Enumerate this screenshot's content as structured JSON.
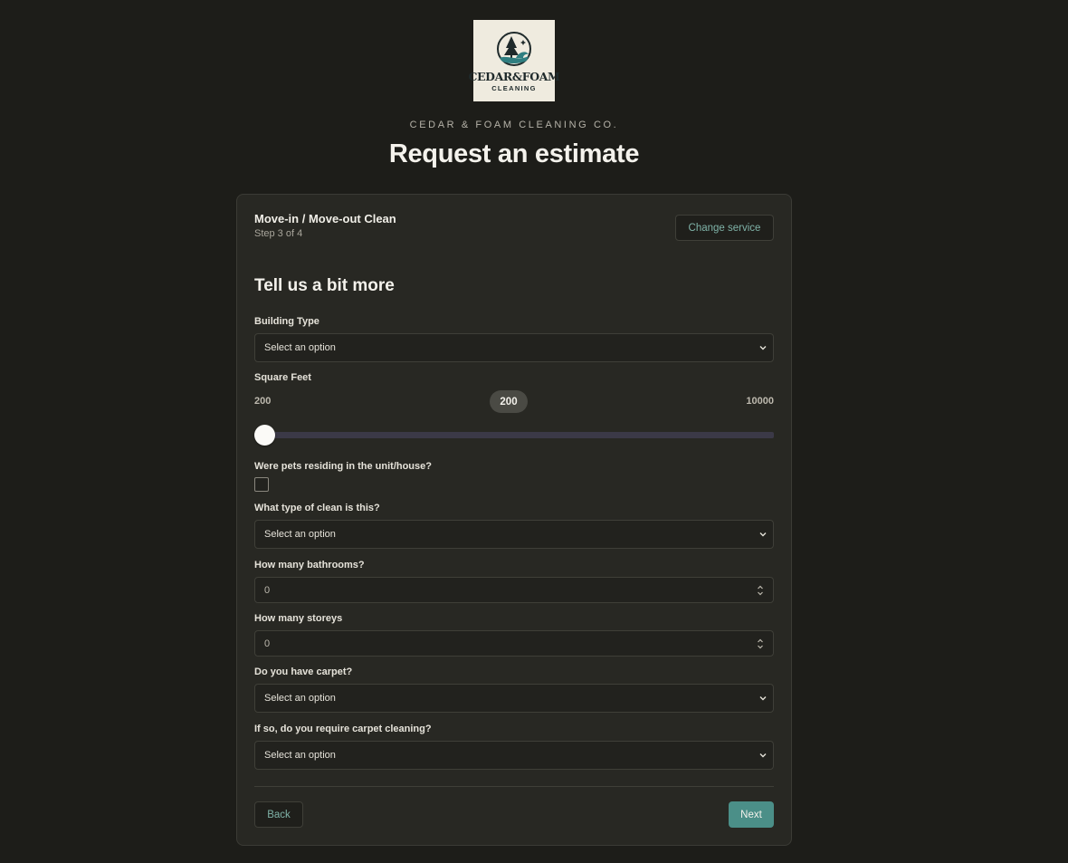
{
  "brand": {
    "logo_line1": "CEDAR&FOAM",
    "logo_line2": "CLEANING",
    "company_name": "CEDAR & FOAM CLEANING CO.",
    "page_title": "Request an estimate",
    "colors": {
      "background": "#1d1d19",
      "card": "#282823",
      "accent": "#4b8f88",
      "accent_text": "#7fb3a8"
    }
  },
  "header": {
    "service_name": "Move-in / Move-out Clean",
    "step_text": "Step 3 of 4",
    "change_service_label": "Change service"
  },
  "form": {
    "section_title": "Tell us a bit more",
    "building_type": {
      "label": "Building Type",
      "value": "Select an option"
    },
    "square_feet": {
      "label": "Square Feet",
      "min": "200",
      "max": "10000",
      "value": "200"
    },
    "pets": {
      "label": "Were pets residing in the unit/house?",
      "checked": false
    },
    "clean_type": {
      "label": "What type of clean is this?",
      "value": "Select an option"
    },
    "bathrooms": {
      "label": "How many bathrooms?",
      "value": "0"
    },
    "storeys": {
      "label": "How many storeys",
      "value": "0"
    },
    "carpet": {
      "label": "Do you have carpet?",
      "value": "Select an option"
    },
    "carpet_cleaning": {
      "label": "If so, do you require carpet cleaning?",
      "value": "Select an option"
    }
  },
  "footer": {
    "back_label": "Back",
    "next_label": "Next"
  }
}
